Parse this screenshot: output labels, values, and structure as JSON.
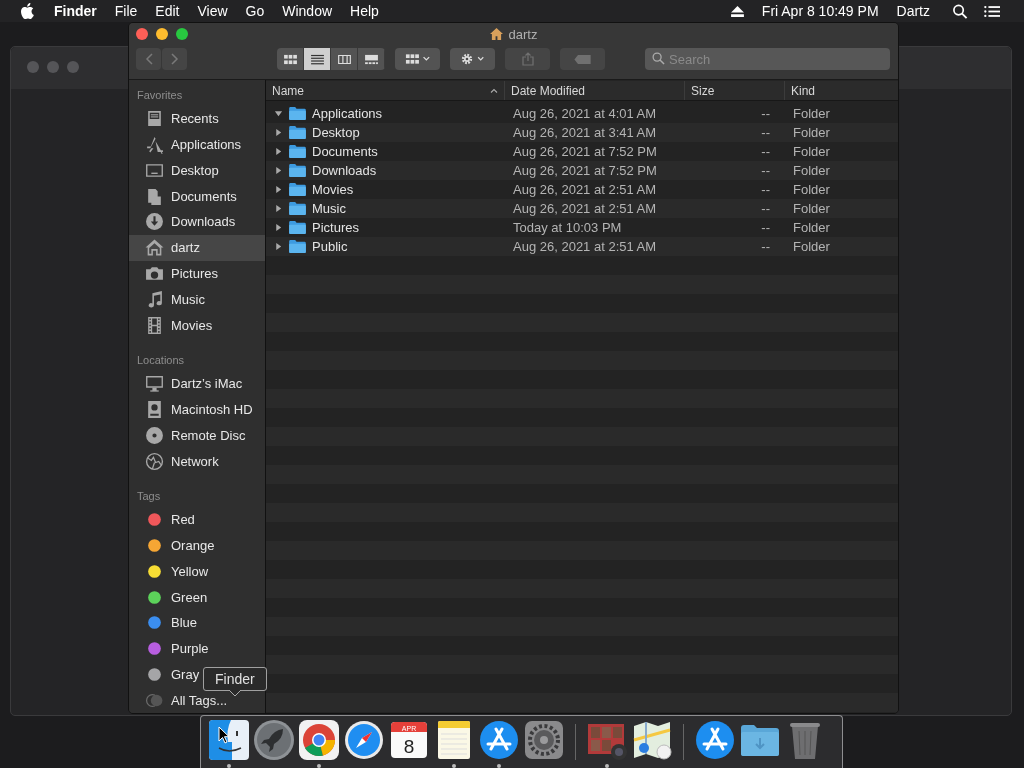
{
  "menu_bar": {
    "app_name": "Finder",
    "menus": [
      "File",
      "Edit",
      "View",
      "Go",
      "Window",
      "Help"
    ],
    "datetime": "Fri Apr 8  10:49 PM",
    "user": "Dartz"
  },
  "window": {
    "title": "dartz",
    "nav": [
      {
        "kind": "back",
        "disabled": true
      },
      {
        "kind": "forward",
        "disabled": true
      }
    ],
    "view_modes": [
      {
        "kind": "icons",
        "selected": false
      },
      {
        "kind": "list",
        "selected": true
      },
      {
        "kind": "columns",
        "selected": false
      },
      {
        "kind": "gallery",
        "selected": false
      }
    ],
    "actions": [
      {
        "kind": "group",
        "disabled": false
      },
      {
        "kind": "gear",
        "disabled": false
      },
      {
        "kind": "share",
        "disabled": true
      },
      {
        "kind": "tag",
        "disabled": true
      }
    ],
    "search": {
      "placeholder": "Search"
    }
  },
  "sidebar": [
    {
      "heading": "Favorites",
      "items": [
        {
          "label": "Recents",
          "kind": "recents",
          "selected": false
        },
        {
          "label": "Applications",
          "kind": "apps",
          "selected": false
        },
        {
          "label": "Desktop",
          "kind": "desktop",
          "selected": false
        },
        {
          "label": "Documents",
          "kind": "documents",
          "selected": false
        },
        {
          "label": "Downloads",
          "kind": "downloads",
          "selected": false
        },
        {
          "label": "dartz",
          "kind": "home",
          "selected": true
        },
        {
          "label": "Pictures",
          "kind": "camera",
          "selected": false
        },
        {
          "label": "Music",
          "kind": "music",
          "selected": false
        },
        {
          "label": "Movies",
          "kind": "film",
          "selected": false
        }
      ]
    },
    {
      "heading": "Locations",
      "items": [
        {
          "label": "Dartz’s iMac",
          "kind": "computer",
          "selected": false
        },
        {
          "label": "Macintosh HD",
          "kind": "drive",
          "selected": false
        },
        {
          "label": "Remote Disc",
          "kind": "disc",
          "selected": false
        },
        {
          "label": "Network",
          "kind": "globe",
          "selected": false
        }
      ]
    },
    {
      "heading": "Tags",
      "items": [
        {
          "label": "Red",
          "kind": "tag",
          "color": "#f0575a",
          "selected": false
        },
        {
          "label": "Orange",
          "kind": "tag",
          "color": "#f6a634",
          "selected": false
        },
        {
          "label": "Yellow",
          "kind": "tag",
          "color": "#f7dd34",
          "selected": false
        },
        {
          "label": "Green",
          "kind": "tag",
          "color": "#5cd25a",
          "selected": false
        },
        {
          "label": "Blue",
          "kind": "tag",
          "color": "#3b8ef0",
          "selected": false
        },
        {
          "label": "Purple",
          "kind": "tag",
          "color": "#b85ee0",
          "selected": false
        },
        {
          "label": "Gray",
          "kind": "tag",
          "color": "#a5a5a7",
          "selected": false
        },
        {
          "label": "All Tags...",
          "kind": "all",
          "selected": false
        }
      ]
    }
  ],
  "table": {
    "columns": [
      {
        "label": "Name",
        "sorted": true
      },
      {
        "label": "Date Modified",
        "sorted": false
      },
      {
        "label": "Size",
        "sorted": false
      },
      {
        "label": "Kind",
        "sorted": false
      }
    ],
    "rows": [
      {
        "name": "Applications",
        "date": "Aug 26, 2021 at 4:01 AM",
        "size": "--",
        "kind": "Folder",
        "expanded": true
      },
      {
        "name": "Desktop",
        "date": "Aug 26, 2021 at 3:41 AM",
        "size": "--",
        "kind": "Folder",
        "expanded": false
      },
      {
        "name": "Documents",
        "date": "Aug 26, 2021 at 7:52 PM",
        "size": "--",
        "kind": "Folder",
        "expanded": false
      },
      {
        "name": "Downloads",
        "date": "Aug 26, 2021 at 7:52 PM",
        "size": "--",
        "kind": "Folder",
        "expanded": false
      },
      {
        "name": "Movies",
        "date": "Aug 26, 2021 at 2:51 AM",
        "size": "--",
        "kind": "Folder",
        "expanded": false
      },
      {
        "name": "Music",
        "date": "Aug 26, 2021 at 2:51 AM",
        "size": "--",
        "kind": "Folder",
        "expanded": false
      },
      {
        "name": "Pictures",
        "date": "Today at 10:03 PM",
        "size": "--",
        "kind": "Folder",
        "expanded": false
      },
      {
        "name": "Public",
        "date": "Aug 26, 2021 at 2:51 AM",
        "size": "--",
        "kind": "Folder",
        "expanded": false
      }
    ]
  },
  "tooltip": {
    "text": "Finder"
  },
  "dock": [
    {
      "kind": "finder",
      "running": true
    },
    {
      "kind": "launchpad",
      "running": false
    },
    {
      "kind": "chrome",
      "running": true
    },
    {
      "kind": "safari",
      "running": false
    },
    {
      "kind": "calendar",
      "running": false,
      "month": "APR",
      "day": "8"
    },
    {
      "kind": "notes",
      "running": true
    },
    {
      "kind": "appstore",
      "running": true
    },
    {
      "kind": "settings",
      "running": false
    },
    {
      "kind": "separator"
    },
    {
      "kind": "photobooth",
      "running": true
    },
    {
      "kind": "maps",
      "running": false
    },
    {
      "kind": "separator"
    },
    {
      "kind": "appstore",
      "running": false
    },
    {
      "kind": "folder",
      "running": false
    },
    {
      "kind": "trash",
      "running": false
    }
  ]
}
